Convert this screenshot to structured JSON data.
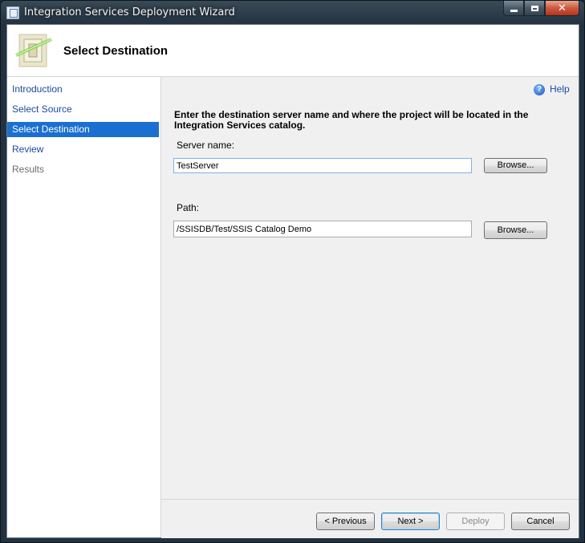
{
  "window": {
    "title": "Integration Services Deployment Wizard",
    "minimize_glyph": "",
    "maximize_glyph": "",
    "close_glyph": "✕"
  },
  "header": {
    "title": "Select Destination",
    "icon": "wizard-icon"
  },
  "nav": {
    "items": [
      {
        "label": "Introduction",
        "state": "link"
      },
      {
        "label": "Select Source",
        "state": "link"
      },
      {
        "label": "Select Destination",
        "state": "selected"
      },
      {
        "label": "Review",
        "state": "link"
      },
      {
        "label": "Results",
        "state": "disabled"
      }
    ]
  },
  "help": {
    "label": "Help",
    "icon_glyph": "?"
  },
  "content": {
    "instruction": "Enter the destination server name and where the project will be located in the Integration Services catalog.",
    "server": {
      "label": "Server name:",
      "value": "TestServer",
      "browse_label": "Browse..."
    },
    "path": {
      "label": "Path:",
      "value": "/SSISDB/Test/SSIS Catalog Demo",
      "browse_label": "Browse..."
    }
  },
  "footer": {
    "previous_label": "< Previous",
    "next_label": "Next >",
    "deploy_label": "Deploy",
    "cancel_label": "Cancel"
  },
  "colors": {
    "nav_selected": "#1b6fd1",
    "link": "#1e4aa0"
  }
}
